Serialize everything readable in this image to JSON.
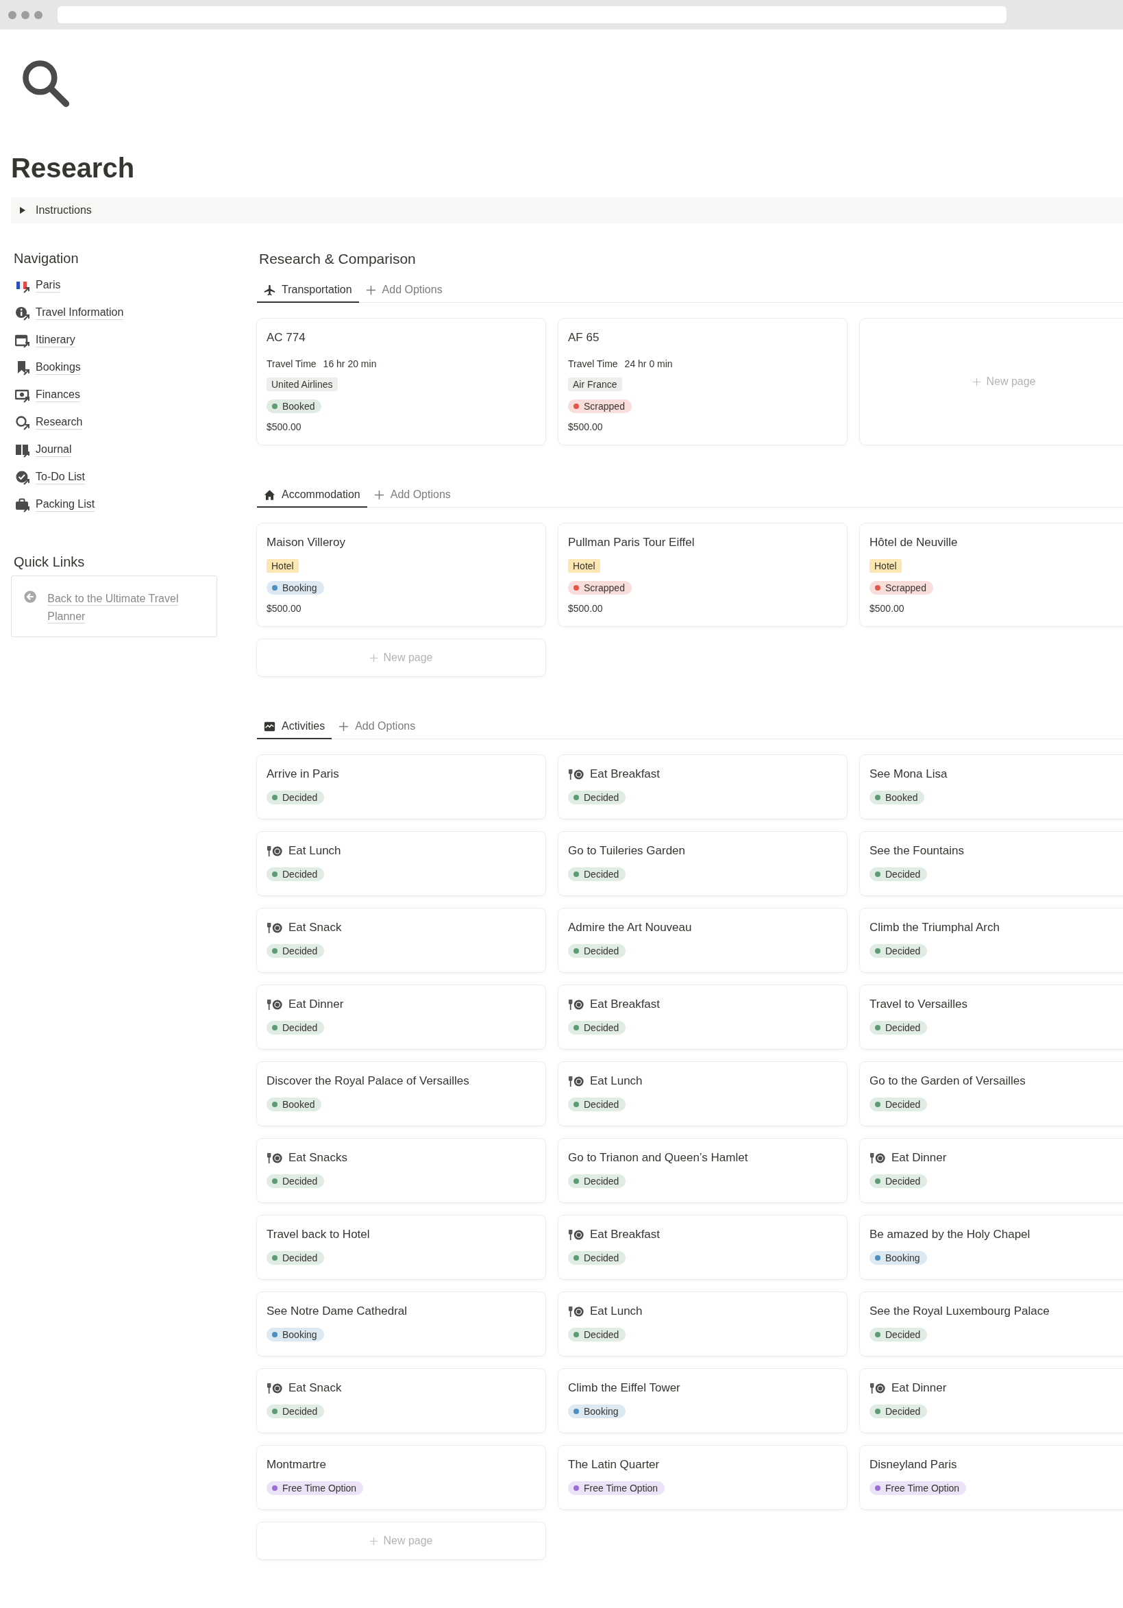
{
  "page": {
    "title": "Research"
  },
  "toggle": {
    "label": "Instructions",
    "expanded": false
  },
  "navigation": {
    "heading": "Navigation",
    "items": [
      {
        "label": "Paris"
      },
      {
        "label": "Travel Information"
      },
      {
        "label": "Itinerary"
      },
      {
        "label": "Bookings"
      },
      {
        "label": "Finances"
      },
      {
        "label": "Research"
      },
      {
        "label": "Journal"
      },
      {
        "label": "To-Do List"
      },
      {
        "label": "Packing List"
      }
    ]
  },
  "quick_links": {
    "heading": "Quick Links",
    "items": [
      {
        "label": "Back to the Ultimate Travel Planner"
      }
    ]
  },
  "main": {
    "heading": "Research & Comparison",
    "sections": [
      {
        "kind": "transportation",
        "tabs": [
          {
            "label": "Transportation",
            "selected": true
          }
        ],
        "add_label": "Add Options",
        "cards": [
          {
            "kind": "transport",
            "title": "AC 774",
            "detail_label": "Travel Time",
            "detail_value": "16 hr 20 min",
            "tag": {
              "label": "United Airlines",
              "color": "#eeeeec"
            },
            "status": {
              "label": "Booked",
              "color": "#5e9c73"
            },
            "price": "$500.00"
          },
          {
            "kind": "transport",
            "title": "AF 65",
            "detail_label": "Travel Time",
            "detail_value": "24 hr 0 min",
            "tag": {
              "label": "Air France",
              "color": "#eeeeec"
            },
            "status": {
              "label": "Scrapped",
              "color": "#e2564b"
            },
            "price": "$500.00"
          },
          {
            "kind": "new",
            "label": "New page"
          }
        ]
      },
      {
        "kind": "accommodation",
        "tabs": [
          {
            "label": "Accommodation",
            "selected": true
          }
        ],
        "add_label": "Add Options",
        "cards": [
          {
            "kind": "stay",
            "title": "Maison Villeroy",
            "tag": {
              "label": "Hotel",
              "color": "#fbe6b4"
            },
            "status": {
              "label": "Booking",
              "color": "#4e8fbf"
            },
            "price": "$500.00"
          },
          {
            "kind": "stay",
            "title": "Pullman Paris Tour Eiffel",
            "tag": {
              "label": "Hotel",
              "color": "#fbe6b4"
            },
            "status": {
              "label": "Scrapped",
              "color": "#e2564b"
            },
            "price": "$500.00"
          },
          {
            "kind": "stay",
            "title": "Hôtel de Neuville",
            "tag": {
              "label": "Hotel",
              "color": "#fbe6b4"
            },
            "status": {
              "label": "Scrapped",
              "color": "#e2564b"
            },
            "price": "$500.00"
          },
          {
            "kind": "new",
            "label": "New page"
          }
        ]
      },
      {
        "kind": "activities",
        "tabs": [
          {
            "label": "Activities",
            "selected": true
          }
        ],
        "add_label": "Add Options",
        "cards": [
          {
            "kind": "activity",
            "title": "Arrive in Paris",
            "meal": false,
            "status": {
              "label": "Decided",
              "color": "#5e9c73"
            }
          },
          {
            "kind": "activity",
            "title": "Eat Breakfast",
            "meal": true,
            "status": {
              "label": "Decided",
              "color": "#5e9c73"
            }
          },
          {
            "kind": "activity",
            "title": "See Mona Lisa",
            "meal": false,
            "status": {
              "label": "Booked",
              "color": "#5e9c73"
            }
          },
          {
            "kind": "activity",
            "title": "Eat Lunch",
            "meal": true,
            "status": {
              "label": "Decided",
              "color": "#5e9c73"
            }
          },
          {
            "kind": "activity",
            "title": "Go to Tuileries Garden",
            "meal": false,
            "status": {
              "label": "Decided",
              "color": "#5e9c73"
            }
          },
          {
            "kind": "activity",
            "title": "See the Fountains",
            "meal": false,
            "status": {
              "label": "Decided",
              "color": "#5e9c73"
            }
          },
          {
            "kind": "activity",
            "title": "Eat Snack",
            "meal": true,
            "status": {
              "label": "Decided",
              "color": "#5e9c73"
            }
          },
          {
            "kind": "activity",
            "title": "Admire the Art Nouveau",
            "meal": false,
            "status": {
              "label": "Decided",
              "color": "#5e9c73"
            }
          },
          {
            "kind": "activity",
            "title": "Climb the Triumphal Arch",
            "meal": false,
            "status": {
              "label": "Decided",
              "color": "#5e9c73"
            }
          },
          {
            "kind": "activity",
            "title": "Eat Dinner",
            "meal": true,
            "status": {
              "label": "Decided",
              "color": "#5e9c73"
            }
          },
          {
            "kind": "activity",
            "title": "Eat Breakfast",
            "meal": true,
            "status": {
              "label": "Decided",
              "color": "#5e9c73"
            }
          },
          {
            "kind": "activity",
            "title": "Travel to Versailles",
            "meal": false,
            "status": {
              "label": "Decided",
              "color": "#5e9c73"
            }
          },
          {
            "kind": "activity",
            "title": "Discover the Royal Palace of Versailles",
            "meal": false,
            "status": {
              "label": "Booked",
              "color": "#5e9c73"
            }
          },
          {
            "kind": "activity",
            "title": "Eat Lunch",
            "meal": true,
            "status": {
              "label": "Decided",
              "color": "#5e9c73"
            }
          },
          {
            "kind": "activity",
            "title": "Go to the Garden of Versailles",
            "meal": false,
            "status": {
              "label": "Decided",
              "color": "#5e9c73"
            }
          },
          {
            "kind": "activity",
            "title": "Eat Snacks",
            "meal": true,
            "status": {
              "label": "Decided",
              "color": "#5e9c73"
            }
          },
          {
            "kind": "activity",
            "title": "Go to Trianon and Queen’s Hamlet",
            "meal": false,
            "status": {
              "label": "Decided",
              "color": "#5e9c73"
            }
          },
          {
            "kind": "activity",
            "title": "Eat Dinner",
            "meal": true,
            "status": {
              "label": "Decided",
              "color": "#5e9c73"
            }
          },
          {
            "kind": "activity",
            "title": "Travel back to Hotel",
            "meal": false,
            "status": {
              "label": "Decided",
              "color": "#5e9c73"
            }
          },
          {
            "kind": "activity",
            "title": "Eat Breakfast",
            "meal": true,
            "status": {
              "label": "Decided",
              "color": "#5e9c73"
            }
          },
          {
            "kind": "activity",
            "title": "Be amazed by the Holy Chapel",
            "meal": false,
            "status": {
              "label": "Booking",
              "color": "#4e8fbf"
            }
          },
          {
            "kind": "activity",
            "title": "See Notre Dame Cathedral",
            "meal": false,
            "status": {
              "label": "Booking",
              "color": "#4e8fbf"
            }
          },
          {
            "kind": "activity",
            "title": "Eat Lunch",
            "meal": true,
            "status": {
              "label": "Decided",
              "color": "#5e9c73"
            }
          },
          {
            "kind": "activity",
            "title": "See the Royal Luxembourg Palace",
            "meal": false,
            "status": {
              "label": "Decided",
              "color": "#5e9c73"
            }
          },
          {
            "kind": "activity",
            "title": "Eat Snack",
            "meal": true,
            "status": {
              "label": "Decided",
              "color": "#5e9c73"
            }
          },
          {
            "kind": "activity",
            "title": "Climb the Eiffel Tower",
            "meal": false,
            "status": {
              "label": "Booking",
              "color": "#4e8fbf"
            }
          },
          {
            "kind": "activity",
            "title": "Eat Dinner",
            "meal": true,
            "status": {
              "label": "Decided",
              "color": "#5e9c73"
            }
          },
          {
            "kind": "activity",
            "title": "Montmartre",
            "meal": false,
            "status": {
              "label": "Free Time Option",
              "color": "#9a6dd7"
            }
          },
          {
            "kind": "activity",
            "title": "The Latin Quarter",
            "meal": false,
            "status": {
              "label": "Free Time Option",
              "color": "#9a6dd7"
            }
          },
          {
            "kind": "activity",
            "title": "Disneyland Paris",
            "meal": false,
            "status": {
              "label": "Free Time Option",
              "color": "#9a6dd7"
            }
          },
          {
            "kind": "new",
            "label": "New page"
          }
        ]
      }
    ]
  }
}
